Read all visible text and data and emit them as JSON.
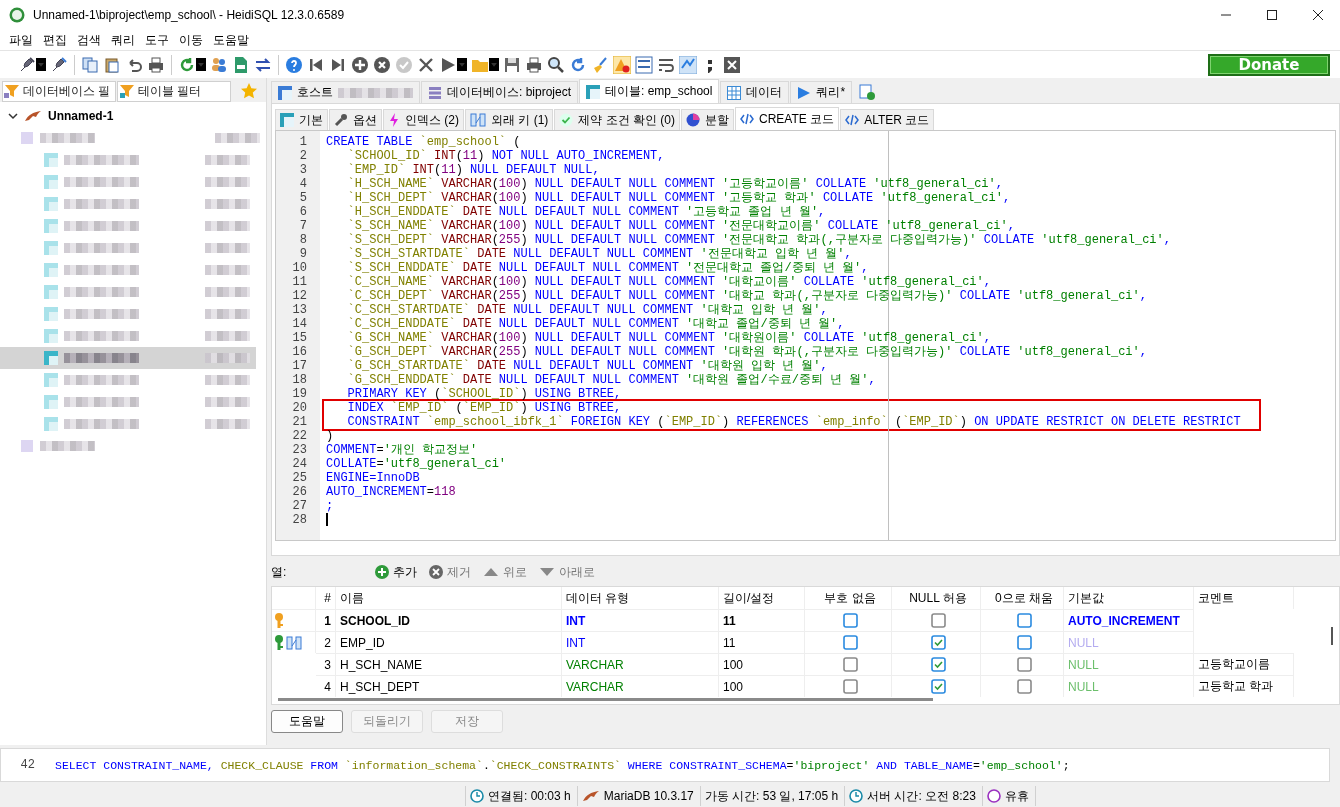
{
  "window": {
    "title": "Unnamed-1\\biproject\\emp_school\\ - HeidiSQL 12.3.0.6589"
  },
  "menu": [
    "파일",
    "편집",
    "검색",
    "쿼리",
    "도구",
    "이동",
    "도움말"
  ],
  "donate_button": "Donate",
  "filters": [
    {
      "placeholder": "데이터베이스 필"
    },
    {
      "placeholder": "테이블 필터"
    }
  ],
  "tree": {
    "label": "Unnamed-1",
    "expanded": true,
    "children": [
      {
        "selected": false,
        "children": [
          {
            "selected": false
          },
          {
            "selected": false
          },
          {
            "selected": false
          },
          {
            "selected": false
          },
          {
            "selected": false
          },
          {
            "selected": false
          },
          {
            "selected": false
          },
          {
            "selected": false
          },
          {
            "selected": false
          },
          {
            "selected": true
          },
          {
            "selected": false
          },
          {
            "selected": false
          },
          {
            "selected": false
          }
        ]
      },
      {
        "selected": false
      }
    ]
  },
  "tabs": [
    {
      "kind": "host",
      "label": "호스트",
      "redacted": true,
      "selected": false
    },
    {
      "kind": "database",
      "label": "데이터베이스: biproject",
      "selected": false
    },
    {
      "kind": "table",
      "label": "테이블: emp_school",
      "selected": true
    },
    {
      "kind": "data",
      "label": "데이터",
      "selected": false
    },
    {
      "kind": "query",
      "label": "쿼리*",
      "selected": false
    }
  ],
  "subtabs": [
    {
      "kind": "basic",
      "label": "기본",
      "selected": false
    },
    {
      "kind": "options",
      "label": "옵션",
      "selected": false
    },
    {
      "kind": "indexes",
      "label": "인덱스 (2)",
      "selected": false
    },
    {
      "kind": "foreign",
      "label": "외래 키 (1)",
      "selected": false
    },
    {
      "kind": "check",
      "label": "제약 조건 확인 (0)",
      "selected": false
    },
    {
      "kind": "partition",
      "label": "분할",
      "selected": false
    },
    {
      "kind": "code",
      "label": "CREATE 코드",
      "selected": true
    },
    {
      "kind": "code",
      "label": "ALTER 코드",
      "selected": false
    }
  ],
  "code": [
    {
      "number": "1",
      "tokens": [
        {
          "kind": "keyword",
          "text": "CREATE TABLE"
        },
        {
          "kind": "identifier",
          "text": " `emp_school`"
        },
        {
          "kind": "plain",
          "text": " ("
        }
      ]
    },
    {
      "number": "2",
      "tokens": [
        {
          "kind": "identifier",
          "text": "   `SCHOOL_ID`"
        },
        {
          "kind": "type",
          "text": " INT"
        },
        {
          "kind": "plain",
          "text": "("
        },
        {
          "kind": "number",
          "text": "11"
        },
        {
          "kind": "plain",
          "text": ")"
        },
        {
          "kind": "keyword",
          "text": " NOT NULL AUTO_INCREMENT,"
        }
      ]
    },
    {
      "number": "3",
      "tokens": [
        {
          "kind": "identifier",
          "text": "   `EMP_ID`"
        },
        {
          "kind": "type",
          "text": " INT"
        },
        {
          "kind": "plain",
          "text": "("
        },
        {
          "kind": "number",
          "text": "11"
        },
        {
          "kind": "plain",
          "text": ")"
        },
        {
          "kind": "keyword",
          "text": " NULL DEFAULT NULL,"
        }
      ]
    },
    {
      "number": "4",
      "tokens": [
        {
          "kind": "identifier",
          "text": "   `H_SCH_NAME`"
        },
        {
          "kind": "type",
          "text": " VARCHAR"
        },
        {
          "kind": "plain",
          "text": "("
        },
        {
          "kind": "number",
          "text": "100"
        },
        {
          "kind": "plain",
          "text": ")"
        },
        {
          "kind": "keyword",
          "text": " NULL DEFAULT NULL COMMENT"
        },
        {
          "kind": "string",
          "text": " '고등학교이름'"
        },
        {
          "kind": "keyword",
          "text": " COLLATE"
        },
        {
          "kind": "string",
          "text": " 'utf8_general_ci'"
        },
        {
          "kind": "keyword",
          "text": ","
        }
      ]
    },
    {
      "number": "5",
      "tokens": [
        {
          "kind": "identifier",
          "text": "   `H_SCH_DEPT`"
        },
        {
          "kind": "type",
          "text": " VARCHAR"
        },
        {
          "kind": "plain",
          "text": "("
        },
        {
          "kind": "number",
          "text": "100"
        },
        {
          "kind": "plain",
          "text": ")"
        },
        {
          "kind": "keyword",
          "text": " NULL DEFAULT NULL COMMENT"
        },
        {
          "kind": "string",
          "text": " '고등학교 학과'"
        },
        {
          "kind": "keyword",
          "text": " COLLATE"
        },
        {
          "kind": "string",
          "text": " 'utf8_general_ci'"
        },
        {
          "kind": "keyword",
          "text": ","
        }
      ]
    },
    {
      "number": "6",
      "tokens": [
        {
          "kind": "identifier",
          "text": "   `H_SCH_ENDDATE`"
        },
        {
          "kind": "type",
          "text": " DATE"
        },
        {
          "kind": "keyword",
          "text": " NULL DEFAULT NULL COMMENT"
        },
        {
          "kind": "string",
          "text": " '고등학교 졸업 년 월'"
        },
        {
          "kind": "keyword",
          "text": ","
        }
      ]
    },
    {
      "number": "7",
      "tokens": [
        {
          "kind": "identifier",
          "text": "   `S_SCH_NAME`"
        },
        {
          "kind": "type",
          "text": " VARCHAR"
        },
        {
          "kind": "plain",
          "text": "("
        },
        {
          "kind": "number",
          "text": "100"
        },
        {
          "kind": "plain",
          "text": ")"
        },
        {
          "kind": "keyword",
          "text": " NULL DEFAULT NULL COMMENT"
        },
        {
          "kind": "string",
          "text": " '전문대학교이름'"
        },
        {
          "kind": "keyword",
          "text": " COLLATE"
        },
        {
          "kind": "string",
          "text": " 'utf8_general_ci'"
        },
        {
          "kind": "keyword",
          "text": ","
        }
      ]
    },
    {
      "number": "8",
      "tokens": [
        {
          "kind": "identifier",
          "text": "   `S_SCH_DEPT`"
        },
        {
          "kind": "type",
          "text": " VARCHAR"
        },
        {
          "kind": "plain",
          "text": "("
        },
        {
          "kind": "number",
          "text": "255"
        },
        {
          "kind": "plain",
          "text": ")"
        },
        {
          "kind": "keyword",
          "text": " NULL DEFAULT NULL COMMENT"
        },
        {
          "kind": "string",
          "text": " '전문대학교 학과(,구분자로 다중입력가능)'"
        },
        {
          "kind": "keyword",
          "text": " COLLATE"
        },
        {
          "kind": "string",
          "text": " 'utf8_general_ci'"
        },
        {
          "kind": "keyword",
          "text": ","
        }
      ]
    },
    {
      "number": "9",
      "tokens": [
        {
          "kind": "identifier",
          "text": "   `S_SCH_STARTDATE`"
        },
        {
          "kind": "type",
          "text": " DATE"
        },
        {
          "kind": "keyword",
          "text": " NULL DEFAULT NULL COMMENT"
        },
        {
          "kind": "string",
          "text": " '전문대학교 입학 년 월'"
        },
        {
          "kind": "keyword",
          "text": ","
        }
      ]
    },
    {
      "number": "10",
      "tokens": [
        {
          "kind": "identifier",
          "text": "   `S_SCH_ENDDATE`"
        },
        {
          "kind": "type",
          "text": " DATE"
        },
        {
          "kind": "keyword",
          "text": " NULL DEFAULT NULL COMMENT"
        },
        {
          "kind": "string",
          "text": " '전문대학교 졸업/중퇴 년 월'"
        },
        {
          "kind": "keyword",
          "text": ","
        }
      ]
    },
    {
      "number": "11",
      "tokens": [
        {
          "kind": "identifier",
          "text": "   `C_SCH_NAME`"
        },
        {
          "kind": "type",
          "text": " VARCHAR"
        },
        {
          "kind": "plain",
          "text": "("
        },
        {
          "kind": "number",
          "text": "100"
        },
        {
          "kind": "plain",
          "text": ")"
        },
        {
          "kind": "keyword",
          "text": " NULL DEFAULT NULL COMMENT"
        },
        {
          "kind": "string",
          "text": " '대학교이름'"
        },
        {
          "kind": "keyword",
          "text": " COLLATE"
        },
        {
          "kind": "string",
          "text": " 'utf8_general_ci'"
        },
        {
          "kind": "keyword",
          "text": ","
        }
      ]
    },
    {
      "number": "12",
      "tokens": [
        {
          "kind": "identifier",
          "text": "   `C_SCH_DEPT`"
        },
        {
          "kind": "type",
          "text": " VARCHAR"
        },
        {
          "kind": "plain",
          "text": "("
        },
        {
          "kind": "number",
          "text": "255"
        },
        {
          "kind": "plain",
          "text": ")"
        },
        {
          "kind": "keyword",
          "text": " NULL DEFAULT NULL COMMENT"
        },
        {
          "kind": "string",
          "text": " '대학교 학과(,구분자로 다중입력가능)'"
        },
        {
          "kind": "keyword",
          "text": " COLLATE"
        },
        {
          "kind": "string",
          "text": " 'utf8_general_ci'"
        },
        {
          "kind": "keyword",
          "text": ","
        }
      ]
    },
    {
      "number": "13",
      "tokens": [
        {
          "kind": "identifier",
          "text": "   `C_SCH_STARTDATE`"
        },
        {
          "kind": "type",
          "text": " DATE"
        },
        {
          "kind": "keyword",
          "text": " NULL DEFAULT NULL COMMENT"
        },
        {
          "kind": "string",
          "text": " '대학교 입학 년 월'"
        },
        {
          "kind": "keyword",
          "text": ","
        }
      ]
    },
    {
      "number": "14",
      "tokens": [
        {
          "kind": "identifier",
          "text": "   `C_SCH_ENDDATE`"
        },
        {
          "kind": "type",
          "text": " DATE"
        },
        {
          "kind": "keyword",
          "text": " NULL DEFAULT NULL COMMENT"
        },
        {
          "kind": "string",
          "text": " '대학교 졸업/중퇴 년 월'"
        },
        {
          "kind": "keyword",
          "text": ","
        }
      ]
    },
    {
      "number": "15",
      "tokens": [
        {
          "kind": "identifier",
          "text": "   `G_SCH_NAME`"
        },
        {
          "kind": "type",
          "text": " VARCHAR"
        },
        {
          "kind": "plain",
          "text": "("
        },
        {
          "kind": "number",
          "text": "100"
        },
        {
          "kind": "plain",
          "text": ")"
        },
        {
          "kind": "keyword",
          "text": " NULL DEFAULT NULL COMMENT"
        },
        {
          "kind": "string",
          "text": " '대학원이름'"
        },
        {
          "kind": "keyword",
          "text": " COLLATE"
        },
        {
          "kind": "string",
          "text": " 'utf8_general_ci'"
        },
        {
          "kind": "keyword",
          "text": ","
        }
      ]
    },
    {
      "number": "16",
      "tokens": [
        {
          "kind": "identifier",
          "text": "   `G_SCH_DEPT`"
        },
        {
          "kind": "type",
          "text": " VARCHAR"
        },
        {
          "kind": "plain",
          "text": "("
        },
        {
          "kind": "number",
          "text": "255"
        },
        {
          "kind": "plain",
          "text": ")"
        },
        {
          "kind": "keyword",
          "text": " NULL DEFAULT NULL COMMENT"
        },
        {
          "kind": "string",
          "text": " '대학원 학과(,구분자로 다중입력가능)'"
        },
        {
          "kind": "keyword",
          "text": " COLLATE"
        },
        {
          "kind": "string",
          "text": " 'utf8_general_ci'"
        },
        {
          "kind": "keyword",
          "text": ","
        }
      ]
    },
    {
      "number": "17",
      "tokens": [
        {
          "kind": "identifier",
          "text": "   `G_SCH_STARTDATE`"
        },
        {
          "kind": "type",
          "text": " DATE"
        },
        {
          "kind": "keyword",
          "text": " NULL DEFAULT NULL COMMENT"
        },
        {
          "kind": "string",
          "text": " '대학원 입학 년 월'"
        },
        {
          "kind": "keyword",
          "text": ","
        }
      ]
    },
    {
      "number": "18",
      "tokens": [
        {
          "kind": "identifier",
          "text": "   `G_SCH_ENDDATE`"
        },
        {
          "kind": "type",
          "text": " DATE"
        },
        {
          "kind": "keyword",
          "text": " NULL DEFAULT NULL COMMENT"
        },
        {
          "kind": "string",
          "text": " '대학원 졸업/수료/중퇴 년 월'"
        },
        {
          "kind": "keyword",
          "text": ","
        }
      ]
    },
    {
      "number": "19",
      "tokens": [
        {
          "kind": "keyword",
          "text": "   PRIMARY KEY"
        },
        {
          "kind": "plain",
          "text": " ("
        },
        {
          "kind": "identifier",
          "text": "`SCHOOL_ID`"
        },
        {
          "kind": "plain",
          "text": ")"
        },
        {
          "kind": "keyword",
          "text": " USING BTREE,"
        }
      ]
    },
    {
      "number": "20",
      "highlighted": true,
      "tokens": [
        {
          "kind": "keyword",
          "text": "   INDEX"
        },
        {
          "kind": "identifier",
          "text": " `EMP_ID`"
        },
        {
          "kind": "plain",
          "text": " ("
        },
        {
          "kind": "identifier",
          "text": "`EMP_ID`"
        },
        {
          "kind": "plain",
          "text": ")"
        },
        {
          "kind": "keyword",
          "text": " USING BTREE,"
        }
      ]
    },
    {
      "number": "21",
      "highlighted": true,
      "tokens": [
        {
          "kind": "keyword",
          "text": "   CONSTRAINT"
        },
        {
          "kind": "identifier",
          "text": " `emp_school_ibfk_1`"
        },
        {
          "kind": "keyword",
          "text": " FOREIGN KEY"
        },
        {
          "kind": "plain",
          "text": " ("
        },
        {
          "kind": "identifier",
          "text": "`EMP_ID`"
        },
        {
          "kind": "plain",
          "text": ")"
        },
        {
          "kind": "keyword",
          "text": " REFERENCES"
        },
        {
          "kind": "identifier",
          "text": " `emp_info`"
        },
        {
          "kind": "plain",
          "text": " ("
        },
        {
          "kind": "identifier",
          "text": "`EMP_ID`"
        },
        {
          "kind": "plain",
          "text": ")"
        },
        {
          "kind": "keyword",
          "text": " ON UPDATE RESTRICT ON DELETE RESTRICT"
        }
      ]
    },
    {
      "number": "22",
      "tokens": [
        {
          "kind": "plain",
          "text": ")"
        }
      ]
    },
    {
      "number": "23",
      "tokens": [
        {
          "kind": "keyword",
          "text": "COMMENT"
        },
        {
          "kind": "plain",
          "text": "="
        },
        {
          "kind": "string",
          "text": "'개인 학교정보'"
        }
      ]
    },
    {
      "number": "24",
      "tokens": [
        {
          "kind": "keyword",
          "text": "COLLATE"
        },
        {
          "kind": "plain",
          "text": "="
        },
        {
          "kind": "string",
          "text": "'utf8_general_ci'"
        }
      ]
    },
    {
      "number": "25",
      "tokens": [
        {
          "kind": "keyword",
          "text": "ENGINE=InnoDB"
        }
      ]
    },
    {
      "number": "26",
      "tokens": [
        {
          "kind": "keyword",
          "text": "AUTO_INCREMENT"
        },
        {
          "kind": "plain",
          "text": "="
        },
        {
          "kind": "number",
          "text": "118"
        }
      ]
    },
    {
      "number": "27",
      "tokens": [
        {
          "kind": "keyword",
          "text": ";"
        }
      ]
    },
    {
      "number": "28",
      "cursor": true
    }
  ],
  "columns_toolbar": {
    "label": "열:",
    "buttons": [
      {
        "kind": "add",
        "label": "추가",
        "disabled": false
      },
      {
        "kind": "remove",
        "label": "제거",
        "disabled": true
      },
      {
        "kind": "up",
        "label": "위로",
        "disabled": true
      },
      {
        "kind": "down",
        "label": "아래로",
        "disabled": true
      }
    ]
  },
  "columns_table": {
    "headers": [
      "#",
      "이름",
      "데이터 유형",
      "길이/설정",
      "부호 없음",
      "NULL 허용",
      "0으로 채움",
      "기본값",
      "코멘트"
    ],
    "rows": [
      {
        "keys": [
          {
            "kind": "primary"
          }
        ],
        "number": "1",
        "name": "SCHOOL_ID",
        "type": {
          "kind": "integer",
          "text": "INT"
        },
        "length": "11",
        "unsigned": {
          "checked": false,
          "disabled": false
        },
        "allow_null": {
          "checked": false,
          "disabled": true
        },
        "zerofill": {
          "checked": false,
          "disabled": false
        },
        "default": {
          "kind": "expression",
          "text": "AUTO_INCREMENT"
        },
        "selected": true
      },
      {
        "keys": [
          {
            "kind": "index"
          },
          {
            "kind": "foreign"
          }
        ],
        "number": "2",
        "name": "EMP_ID",
        "type": {
          "kind": "integer",
          "text": "INT"
        },
        "length": "11",
        "unsigned": {
          "checked": false,
          "disabled": false
        },
        "allow_null": {
          "checked": true,
          "disabled": false
        },
        "zerofill": {
          "checked": false,
          "disabled": false
        },
        "default": {
          "kind": "null",
          "text": "NULL"
        },
        "selected": false
      },
      {
        "number": "3",
        "name": "H_SCH_NAME",
        "type": {
          "kind": "text",
          "text": "VARCHAR"
        },
        "length": "100",
        "unsigned": {
          "checked": false,
          "disabled": true
        },
        "allow_null": {
          "checked": true,
          "disabled": false
        },
        "zerofill": {
          "checked": false,
          "disabled": true
        },
        "default": {
          "kind": "null",
          "text": "NULL"
        },
        "comment": "고등학교이름",
        "selected": false
      },
      {
        "number": "4",
        "name": "H_SCH_DEPT",
        "type": {
          "kind": "text",
          "text": "VARCHAR"
        },
        "length": "100",
        "unsigned": {
          "checked": false,
          "disabled": true
        },
        "allow_null": {
          "checked": true,
          "disabled": false
        },
        "zerofill": {
          "checked": false,
          "disabled": true
        },
        "default": {
          "kind": "null",
          "text": "NULL"
        },
        "comment": "고등학교 학과",
        "selected": false
      }
    ]
  },
  "action_buttons": [
    {
      "label": "도움말",
      "disabled": false
    },
    {
      "label": "되돌리기",
      "disabled": true
    },
    {
      "label": "저장",
      "disabled": true
    }
  ],
  "query_log": {
    "number": "42",
    "tokens": [
      {
        "kind": "keyword",
        "text": "SELECT CONSTRAINT_NAME,"
      },
      {
        "kind": "identifier",
        "text": " CHECK_CLAUSE"
      },
      {
        "kind": "keyword",
        "text": " FROM"
      },
      {
        "kind": "identifier",
        "text": " `information_schema`"
      },
      {
        "kind": "plain",
        "text": "."
      },
      {
        "kind": "identifier",
        "text": "`CHECK_CONSTRAINTS`"
      },
      {
        "kind": "keyword",
        "text": " WHERE CONSTRAINT_SCHEMA"
      },
      {
        "kind": "plain",
        "text": "="
      },
      {
        "kind": "string",
        "text": "'biproject'"
      },
      {
        "kind": "keyword",
        "text": " AND TABLE_NAME"
      },
      {
        "kind": "plain",
        "text": "="
      },
      {
        "kind": "string",
        "text": "'emp_school'"
      },
      {
        "kind": "plain",
        "text": ";"
      }
    ]
  },
  "status_bar": [
    {
      "kind": "connected",
      "text": "연결됨: 00:03 h"
    },
    {
      "kind": "server",
      "text": "MariaDB 10.3.17"
    },
    {
      "kind": "uptime",
      "text": "가동 시간: 53 일, 17:05 h"
    },
    {
      "kind": "server_time",
      "text": "서버 시간: 오전 8:23"
    },
    {
      "kind": "idle",
      "text": "유휴"
    }
  ]
}
